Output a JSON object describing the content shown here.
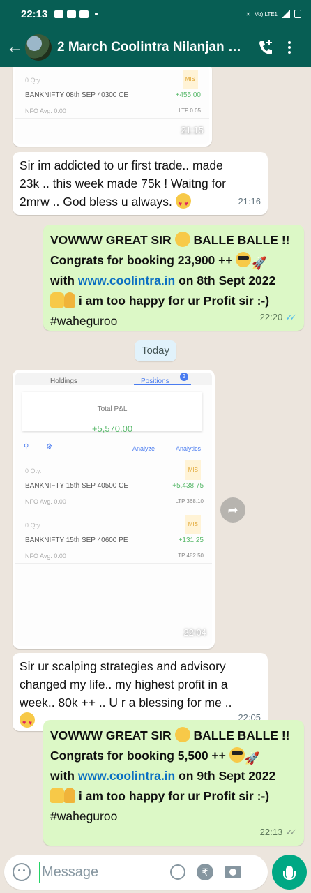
{
  "status_bar": {
    "time": "22:13",
    "network": "Vo) LTE1"
  },
  "header": {
    "title": "2 March Coolintra Nilanjan V..."
  },
  "messages": [
    {
      "type": "image",
      "direction": "in",
      "time": "21:15",
      "screenshot": {
        "rows": [
          {
            "qty": "0 Qty.",
            "tag": "MIS",
            "symbol": "BANKNIFTY 08th SEP 40300 CE",
            "pnl": "+455.00",
            "segment": "NFO  Avg. 0.00",
            "ltp": "LTP 0.05"
          }
        ]
      }
    },
    {
      "type": "text",
      "direction": "in",
      "time": "21:16",
      "lines": [
        "Sir im addicted to ur first trade.. made",
        "23k .. this week made 75k ! Waitng for",
        "2mrw .. God bless u always."
      ]
    },
    {
      "type": "text",
      "direction": "out",
      "time": "22:20",
      "line1": "VOWWW GREAT SIR",
      "line1b": "BALLE BALLE !!",
      "line2": "Congrats for booking 23,900 ++",
      "line3a": "with",
      "link": "www.coolintra.in",
      "line3b": "on 8th Sept 2022",
      "line4": "i am too happy for ur Profit sir :-)",
      "line5": "#waheguroo"
    },
    {
      "type": "image",
      "direction": "in",
      "time": "22:04",
      "screenshot": {
        "tabs": [
          "Holdings",
          "Positions"
        ],
        "positions_count": "2",
        "total_label": "Total P&L",
        "total_value": "+5,570.00",
        "toolbar": {
          "analyze": "Analyze",
          "analytics": "Analytics"
        },
        "rows": [
          {
            "qty": "0 Qty.",
            "tag": "MIS",
            "symbol": "BANKNIFTY 15th SEP 40500 CE",
            "pnl": "+5,438.75",
            "segment": "NFO  Avg. 0.00",
            "ltp": "LTP 368.10"
          },
          {
            "qty": "0 Qty.",
            "tag": "MIS",
            "symbol": "BANKNIFTY 15th SEP 40600 PE",
            "pnl": "+131.25",
            "segment": "NFO  Avg. 0.00",
            "ltp": "LTP 482.50"
          }
        ]
      }
    },
    {
      "type": "text",
      "direction": "in",
      "time": "22:05",
      "lines": [
        "Sir ur scalping strategies and advisory",
        "changed my life.. my highest profit in a",
        "week.. 80k ++ .. U r a blessing for me .."
      ]
    },
    {
      "type": "text",
      "direction": "out",
      "time": "22:13",
      "line1": "VOWWW GREAT SIR",
      "line1b": "BALLE BALLE !!",
      "line2": "Congrats for booking 5,500 ++",
      "line3a": "with",
      "link": "www.coolintra.in",
      "line3b": "on 9th Sept 2022",
      "line4": "i am too happy for ur Profit sir :-)",
      "line5": "#waheguroo"
    }
  ],
  "date_divider": "Today",
  "input": {
    "placeholder": "Message"
  },
  "colors": {
    "header": "#075e54",
    "outgoing": "#dcf8c6",
    "incoming": "#ffffff",
    "link": "#0b6fc2",
    "accent": "#00a884"
  }
}
